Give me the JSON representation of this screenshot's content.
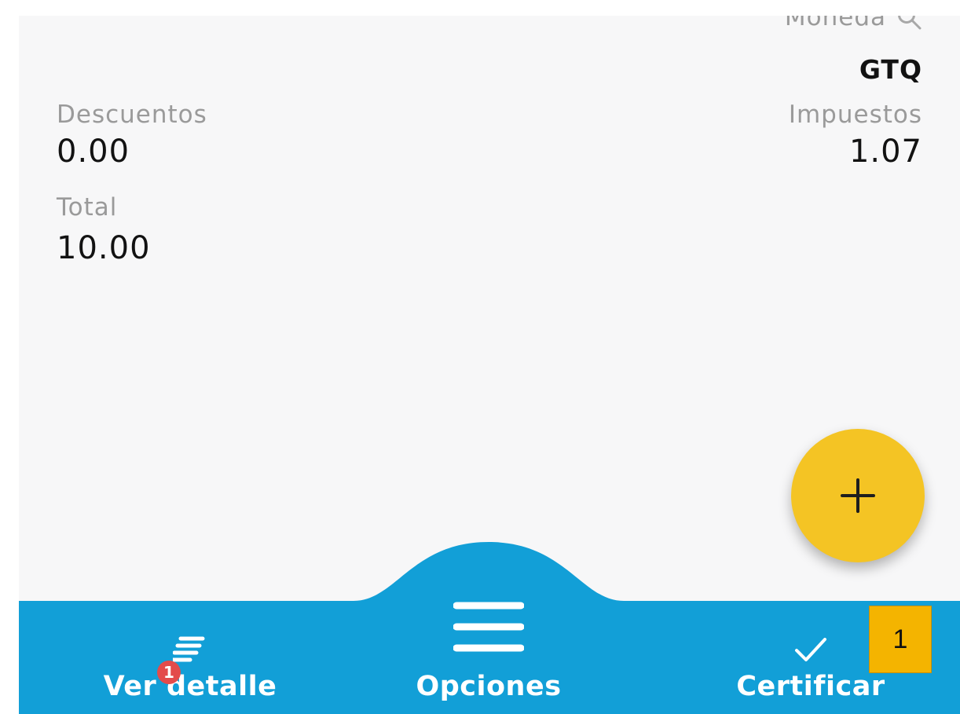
{
  "summary": {
    "moneda_label": "Moneda",
    "moneda_value": "GTQ",
    "descuentos_label": "Descuentos",
    "descuentos_value": "0.00",
    "impuestos_label": "Impuestos",
    "impuestos_value": "1.07",
    "total_label": "Total",
    "total_value": "10.00"
  },
  "fab": {
    "icon": "plus-icon",
    "color": "#f4c424"
  },
  "bottom_nav": {
    "color": "#129fd7",
    "ver_detalle_label": "Ver detalle",
    "ver_detalle_badge": "1",
    "opciones_label": "Opciones",
    "certificar_label": "Certificar"
  },
  "counter_box": {
    "value": "1"
  }
}
